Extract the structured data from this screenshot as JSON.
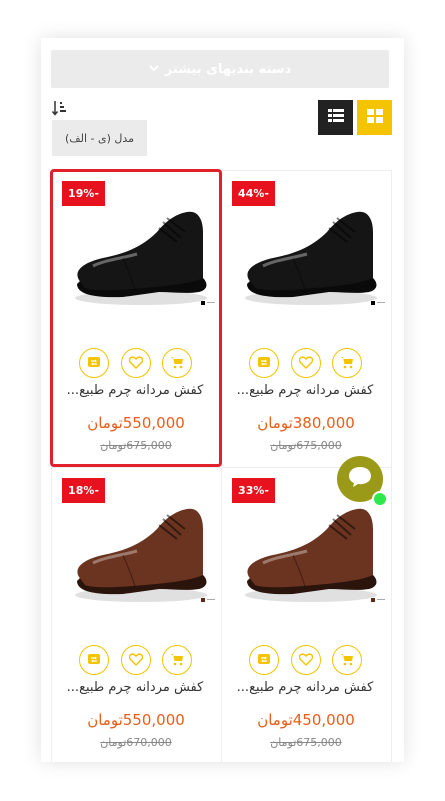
{
  "category_button": {
    "label": "دسته بندیهای بیشتر"
  },
  "sort": {
    "selected": "مدل (ی - الف)"
  },
  "products": [
    {
      "discount": "19%-",
      "title": "کفش مردانه چرم طبیع...",
      "price": "550,000تومان",
      "old_price": "675,000تومان",
      "color": "black",
      "selected": true
    },
    {
      "discount": "44%-",
      "title": "کفش مردانه چرم طبیع...",
      "price": "380,000تومان",
      "old_price": "675,000تومان",
      "color": "black",
      "selected": false
    },
    {
      "discount": "18%-",
      "title": "کفش مردانه چرم طبیع...",
      "price": "550,000تومان",
      "old_price": "670,000تومان",
      "color": "brown",
      "selected": false
    },
    {
      "discount": "33%-",
      "title": "کفش مردانه چرم طبیع...",
      "price": "450,000تومان",
      "old_price": "675,000تومان",
      "color": "brown",
      "selected": false
    }
  ],
  "colors": {
    "accent": "#f5c400",
    "badge": "#e8121e",
    "price": "#e85d1a",
    "selection": "#e0202a",
    "chat": "#9a9a18",
    "online": "#2ee84c"
  },
  "icons": [
    "chevron-down-icon",
    "sort-icon",
    "list-view-icon",
    "grid-view-icon",
    "compare-icon",
    "heart-icon",
    "cart-icon",
    "chat-icon"
  ]
}
